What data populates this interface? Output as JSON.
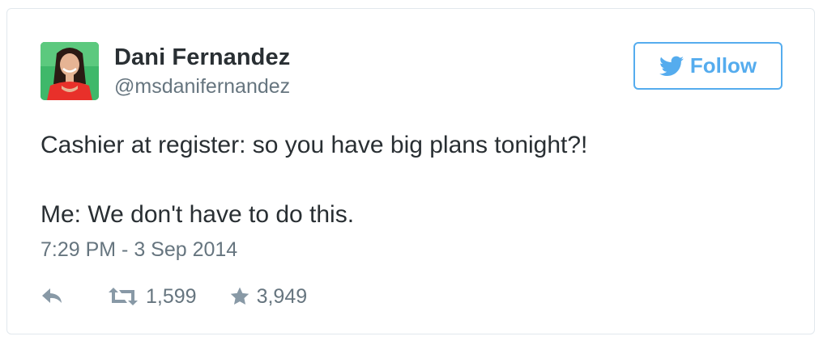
{
  "author": {
    "name": "Dani Fernandez",
    "handle": "@msdanifernandez",
    "avatar": "profile-photo"
  },
  "follow_button": {
    "label": "Follow",
    "icon": "twitter-bird-icon",
    "color": "#55acee"
  },
  "tweet": {
    "lines": [
      "Cashier at register: so you have big plans tonight?!",
      "Me: We don't have to do this."
    ],
    "timestamp": "7:29 PM - 3 Sep 2014"
  },
  "actions": {
    "reply": {
      "icon": "reply-icon"
    },
    "retweet": {
      "icon": "retweet-icon",
      "count": "1,599"
    },
    "favorite": {
      "icon": "star-icon",
      "count": "3,949"
    }
  },
  "colors": {
    "text": "#292f33",
    "secondary": "#66757f",
    "accent": "#55acee",
    "border": "#e1e8ed"
  }
}
